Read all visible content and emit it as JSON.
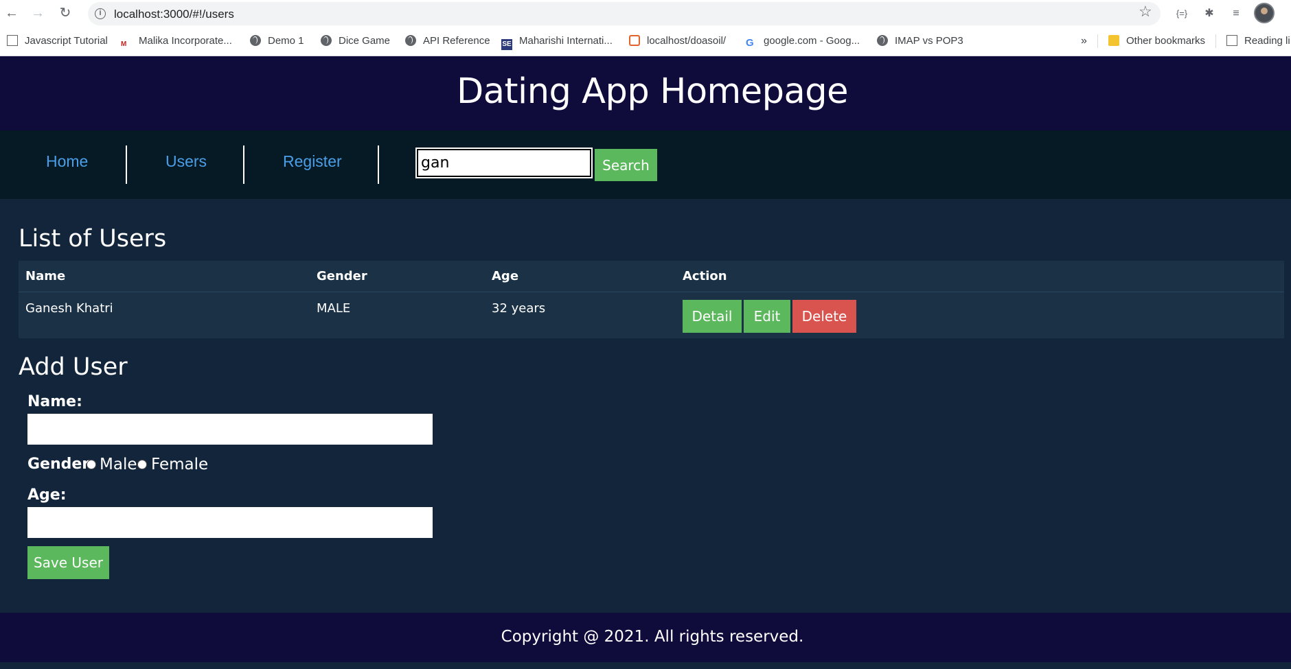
{
  "browser": {
    "url": "localhost:3000/#!/users",
    "bookmarks": [
      {
        "label": "Javascript Tutorial",
        "icon": "page-icon"
      },
      {
        "label": "Malika Incorporate...",
        "icon": "malika-icon"
      },
      {
        "label": "Demo 1",
        "icon": "globe-icon"
      },
      {
        "label": "Dice Game",
        "icon": "globe-icon"
      },
      {
        "label": "API Reference",
        "icon": "globe-icon"
      },
      {
        "label": "Maharishi Internati...",
        "icon": "se-icon"
      },
      {
        "label": "localhost/doasoil/",
        "icon": "xampp-icon"
      },
      {
        "label": "google.com - Goog...",
        "icon": "google-icon"
      },
      {
        "label": "IMAP vs POP3",
        "icon": "globe-icon"
      }
    ],
    "overflow": "»",
    "other_bookmarks": "Other bookmarks",
    "reading_list": "Reading li"
  },
  "header": {
    "title": "Dating App Homepage"
  },
  "nav": {
    "links": [
      "Home",
      "Users",
      "Register"
    ],
    "search_value": "gan",
    "search_button": "Search"
  },
  "users_section": {
    "title": "List of Users",
    "columns": [
      "Name",
      "Gender",
      "Age",
      "Action"
    ],
    "rows": [
      {
        "name": "Ganesh Khatri",
        "gender": "MALE",
        "age": "32 years"
      }
    ],
    "actions": {
      "detail": "Detail",
      "edit": "Edit",
      "delete": "Delete"
    }
  },
  "add_user": {
    "title": "Add User",
    "name_label": "Name:",
    "gender_label": "Gender:",
    "gender_options": [
      "Male",
      "Female"
    ],
    "age_label": "Age:",
    "save_button": "Save User"
  },
  "footer": {
    "text": "Copyright @ 2021. All rights reserved."
  },
  "colors": {
    "header_bg": "#0f0b3b",
    "nav_bg": "#061a26",
    "page_bg": "#12253a",
    "link": "#4a9fe8",
    "success": "#5cb85c",
    "danger": "#d9534f"
  }
}
